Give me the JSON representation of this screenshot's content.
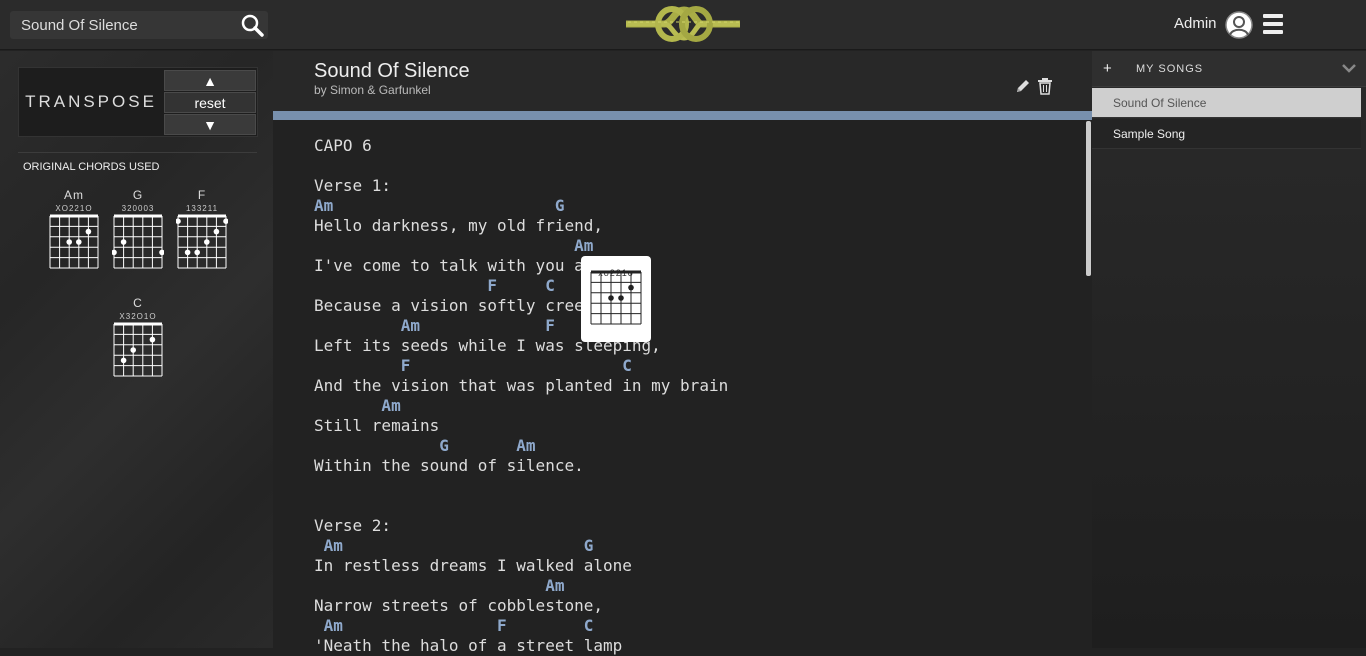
{
  "search": {
    "value": "Sound Of Silence",
    "placeholder": "Sound Of Silence"
  },
  "header": {
    "user": "Admin"
  },
  "transpose": {
    "label": "TRANSPOSE",
    "up": "▲",
    "reset": "reset",
    "down": "▼"
  },
  "original_chords": {
    "title": "ORIGINAL CHORDS USED",
    "chords": [
      {
        "name": "Am",
        "marks": "XO221O"
      },
      {
        "name": "G",
        "marks": "320003"
      },
      {
        "name": "F",
        "marks": "133211"
      },
      {
        "name": "C",
        "marks": "X32O1O"
      }
    ]
  },
  "song": {
    "title": "Sound Of Silence",
    "artist": "by Simon & Garfunkel",
    "lines": [
      {
        "type": "text",
        "text": "CAPO 6"
      },
      {
        "type": "blank",
        "text": ""
      },
      {
        "type": "text",
        "text": "Verse 1:"
      },
      {
        "type": "chord",
        "text": "Am                       G"
      },
      {
        "type": "text",
        "text": "Hello darkness, my old friend,"
      },
      {
        "type": "chord",
        "text": "                           Am"
      },
      {
        "type": "text",
        "text": "I've come to talk with you again"
      },
      {
        "type": "chord",
        "text": "                  F     C"
      },
      {
        "type": "text",
        "text": "Because a vision softly creeping"
      },
      {
        "type": "chord",
        "text": "         Am             F"
      },
      {
        "type": "text",
        "text": "Left its seeds while I was sleeping,"
      },
      {
        "type": "chord",
        "text": "         F                      C"
      },
      {
        "type": "text",
        "text": "And the vision that was planted in my brain"
      },
      {
        "type": "chord",
        "text": "       Am"
      },
      {
        "type": "text",
        "text": "Still remains"
      },
      {
        "type": "chord",
        "text": "             G       Am"
      },
      {
        "type": "text",
        "text": "Within the sound of silence."
      },
      {
        "type": "blank",
        "text": ""
      },
      {
        "type": "blank",
        "text": ""
      },
      {
        "type": "text",
        "text": "Verse 2:"
      },
      {
        "type": "chord",
        "text": " Am                         G"
      },
      {
        "type": "text",
        "text": "In restless dreams I walked alone"
      },
      {
        "type": "chord",
        "text": "                        Am"
      },
      {
        "type": "text",
        "text": "Narrow streets of cobblestone,"
      },
      {
        "type": "chord",
        "text": " Am                F        C"
      },
      {
        "type": "text",
        "text": "'Neath the halo of a street lamp"
      }
    ]
  },
  "popup_chord": {
    "name": "Am",
    "marks": "xo221o"
  },
  "my_songs": {
    "plus": "+",
    "title": "MY SONGS",
    "items": [
      {
        "title": "Sound Of Silence",
        "active": true
      },
      {
        "title": "Sample Song",
        "active": false
      }
    ]
  }
}
